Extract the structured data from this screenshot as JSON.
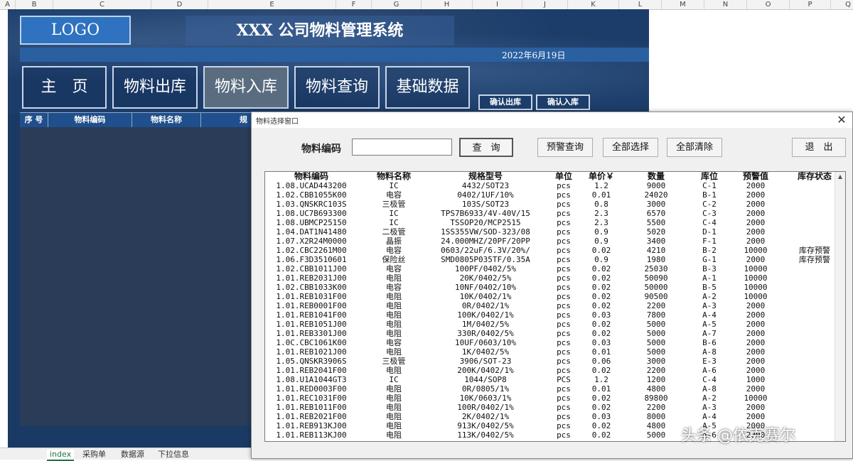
{
  "excel_columns": [
    "A",
    "B",
    "C",
    "D",
    "E",
    "F",
    "G",
    "H",
    "I",
    "J",
    "K",
    "L",
    "M",
    "N",
    "O",
    "P",
    "Q"
  ],
  "dashboard": {
    "logo": "LOGO",
    "title": "XXX 公司物料管理系统",
    "date": "2022年6月19日",
    "nav": [
      "主　页",
      "物料出库",
      "物料入库",
      "物料查询",
      "基础数据"
    ],
    "active_nav": "物料入库",
    "confirm_out": "确认出库",
    "confirm_in": "确认入库",
    "columns": [
      "序 号",
      "物料编码",
      "物料名称",
      "规"
    ],
    "bg_color": "#1a3a64"
  },
  "sheet_tabs": [
    "index",
    "采购单",
    "数据源",
    "下拉信息"
  ],
  "dialog": {
    "title": "物料选择窗口",
    "code_label": "物料编码",
    "code_value": "",
    "buttons": {
      "query": "查　询",
      "alert_query": "预警查询",
      "select_all": "全部选择",
      "clear_all": "全部清除",
      "exit": "退　出"
    },
    "headers": [
      "物料编码",
      "物料名称",
      "规格型号",
      "单位",
      "单价￥",
      "数量",
      "库位",
      "预警值",
      "库存状态"
    ],
    "rows": [
      [
        "1.08.UCAD443200",
        "IC",
        "4432/SOT23",
        "pcs",
        "1.2",
        "9000",
        "C-1",
        "2000",
        ""
      ],
      [
        "1.02.CBB1055K00",
        "电容",
        "0402/1UF/10%",
        "pcs",
        "0.01",
        "24020",
        "B-1",
        "2000",
        ""
      ],
      [
        "1.03.QNSKRC103S",
        "三极管",
        "103S/SOT23",
        "pcs",
        "0.8",
        "3000",
        "C-2",
        "2000",
        ""
      ],
      [
        "1.08.UC7B693300",
        "IC",
        "TPS7B6933/4V-40V/15",
        "pcs",
        "2.3",
        "6570",
        "C-3",
        "2000",
        ""
      ],
      [
        "1.08.UBMCP25150",
        "IC",
        "TSSOP20/MCP2515",
        "pcs",
        "2.3",
        "5500",
        "C-4",
        "2000",
        ""
      ],
      [
        "1.04.DAT1N41480",
        "二极管",
        "1SS355VW/SOD-323/08",
        "pcs",
        "0.9",
        "5020",
        "D-1",
        "2000",
        ""
      ],
      [
        "1.07.X2R24M0000",
        "晶振",
        "24.000MHZ/20PF/20PP",
        "pcs",
        "0.9",
        "3400",
        "F-1",
        "2000",
        ""
      ],
      [
        "1.02.CBC2261M00",
        "电容",
        "0603/22uF/6.3V/20%/",
        "pcs",
        "0.02",
        "4210",
        "B-2",
        "10000",
        "库存预警"
      ],
      [
        "1.06.F3D3510601",
        "保险丝",
        "SMD0805P035TF/0.35A",
        "pcs",
        "0.9",
        "1980",
        "G-1",
        "2000",
        "库存预警"
      ],
      [
        "1.02.CBB1011J00",
        "电容",
        "100PF/0402/5%",
        "pcs",
        "0.02",
        "25030",
        "B-3",
        "10000",
        ""
      ],
      [
        "1.01.REB2031J00",
        "电阻",
        "20K/0402/5%",
        "pcs",
        "0.02",
        "50090",
        "A-1",
        "10000",
        ""
      ],
      [
        "1.02.CBB1033K00",
        "电容",
        "10NF/0402/10%",
        "pcs",
        "0.02",
        "50000",
        "B-5",
        "10000",
        ""
      ],
      [
        "1.01.REB1031F00",
        "电阻",
        "10K/0402/1%",
        "pcs",
        "0.02",
        "90500",
        "A-2",
        "10000",
        ""
      ],
      [
        "1.01.REB0001F00",
        "电阻",
        "0R/0402/1%",
        "pcs",
        "0.02",
        "2200",
        "A-3",
        "2000",
        ""
      ],
      [
        "1.01.REB1041F00",
        "电阻",
        "100K/0402/1%",
        "pcs",
        "0.03",
        "7800",
        "A-4",
        "2000",
        ""
      ],
      [
        "1.01.REB1051J00",
        "电阻",
        "1M/0402/5%",
        "pcs",
        "0.02",
        "5000",
        "A-5",
        "2000",
        ""
      ],
      [
        "1.01.REB3301J00",
        "电阻",
        "330R/0402/5%",
        "pcs",
        "0.02",
        "5000",
        "A-7",
        "2000",
        ""
      ],
      [
        "1.0C.CBC1061K00",
        "电容",
        "10UF/0603/10%",
        "pcs",
        "0.03",
        "5000",
        "B-6",
        "2000",
        ""
      ],
      [
        "1.01.REB1021J00",
        "电阻",
        "1K/0402/5%",
        "pcs",
        "0.01",
        "5000",
        "A-8",
        "2000",
        ""
      ],
      [
        "1.05.QNSKR3906S",
        "三极管",
        "3906/SOT-23",
        "pcs",
        "0.06",
        "3000",
        "E-3",
        "2000",
        ""
      ],
      [
        "1.01.REB2041F00",
        "电阻",
        "200K/0402/1%",
        "pcs",
        "0.02",
        "2200",
        "A-6",
        "2000",
        ""
      ],
      [
        "1.08.U1A1044GT3",
        "IC",
        "1044/SOP8",
        "PCS",
        "1.2",
        "1200",
        "C-4",
        "1000",
        ""
      ],
      [
        "1.01.RED0003F00",
        "电阻",
        "0R/0805/1%",
        "pcs",
        "0.01",
        "4800",
        "A-8",
        "2000",
        ""
      ],
      [
        "1.01.REC1031F00",
        "电阻",
        "10K/0603/1%",
        "pcs",
        "0.02",
        "89800",
        "A-2",
        "10000",
        ""
      ],
      [
        "1.01.REB1011F00",
        "电阻",
        "100R/0402/1%",
        "pcs",
        "0.02",
        "2200",
        "A-3",
        "2000",
        ""
      ],
      [
        "1.01.REB2021F00",
        "电阻",
        "2K/0402/1%",
        "pcs",
        "0.03",
        "8000",
        "A-4",
        "2000",
        ""
      ],
      [
        "1.01.REB913KJ00",
        "电阻",
        "913K/0402/5%",
        "pcs",
        "0.02",
        "4800",
        "A-5",
        "2000",
        ""
      ],
      [
        "1.01.REB113KJ00",
        "电阻",
        "113K/0402/5%",
        "pcs",
        "0.02",
        "5000",
        "A-6",
        "2000",
        ""
      ]
    ]
  },
  "watermark": "头条 @依克赛尔"
}
